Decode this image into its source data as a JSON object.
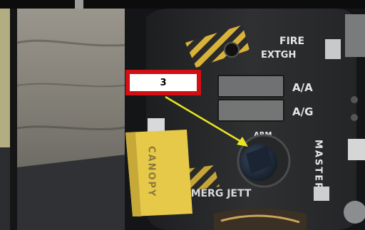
{
  "panel": {
    "fire_extinguish_line1": "FIRE",
    "fire_extinguish_line2": "EXTGH",
    "aa_label": "A/A",
    "ag_label": "A/G",
    "arm_label": "ARM",
    "master_label": "MASTER",
    "emerg_jett_label": "EMERG JETT"
  },
  "handle": {
    "canopy_label": "CANOPY"
  },
  "callout": {
    "number": "3"
  },
  "colors": {
    "callout_border": "#d10f14",
    "arrow": "#e8e622",
    "panel": "#2b2c2e",
    "label_text": "#e6e6e6",
    "canopy_handle": "#e7c94a",
    "stripe_yellow": "#d8b23a"
  }
}
